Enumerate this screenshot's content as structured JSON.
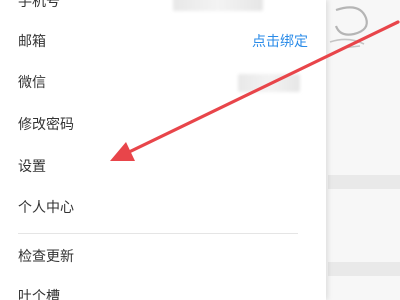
{
  "menu": {
    "phone_label": "手机号",
    "email_label": "邮箱",
    "email_action": "点击绑定",
    "wechat_label": "微信",
    "change_password_label": "修改密码",
    "settings_label": "设置",
    "profile_label": "个人中心",
    "check_update_label": "检查更新",
    "last_label": "吐个槽"
  },
  "colors": {
    "accent": "#2a8be8",
    "arrow": "#e8454a",
    "text": "#333333"
  }
}
